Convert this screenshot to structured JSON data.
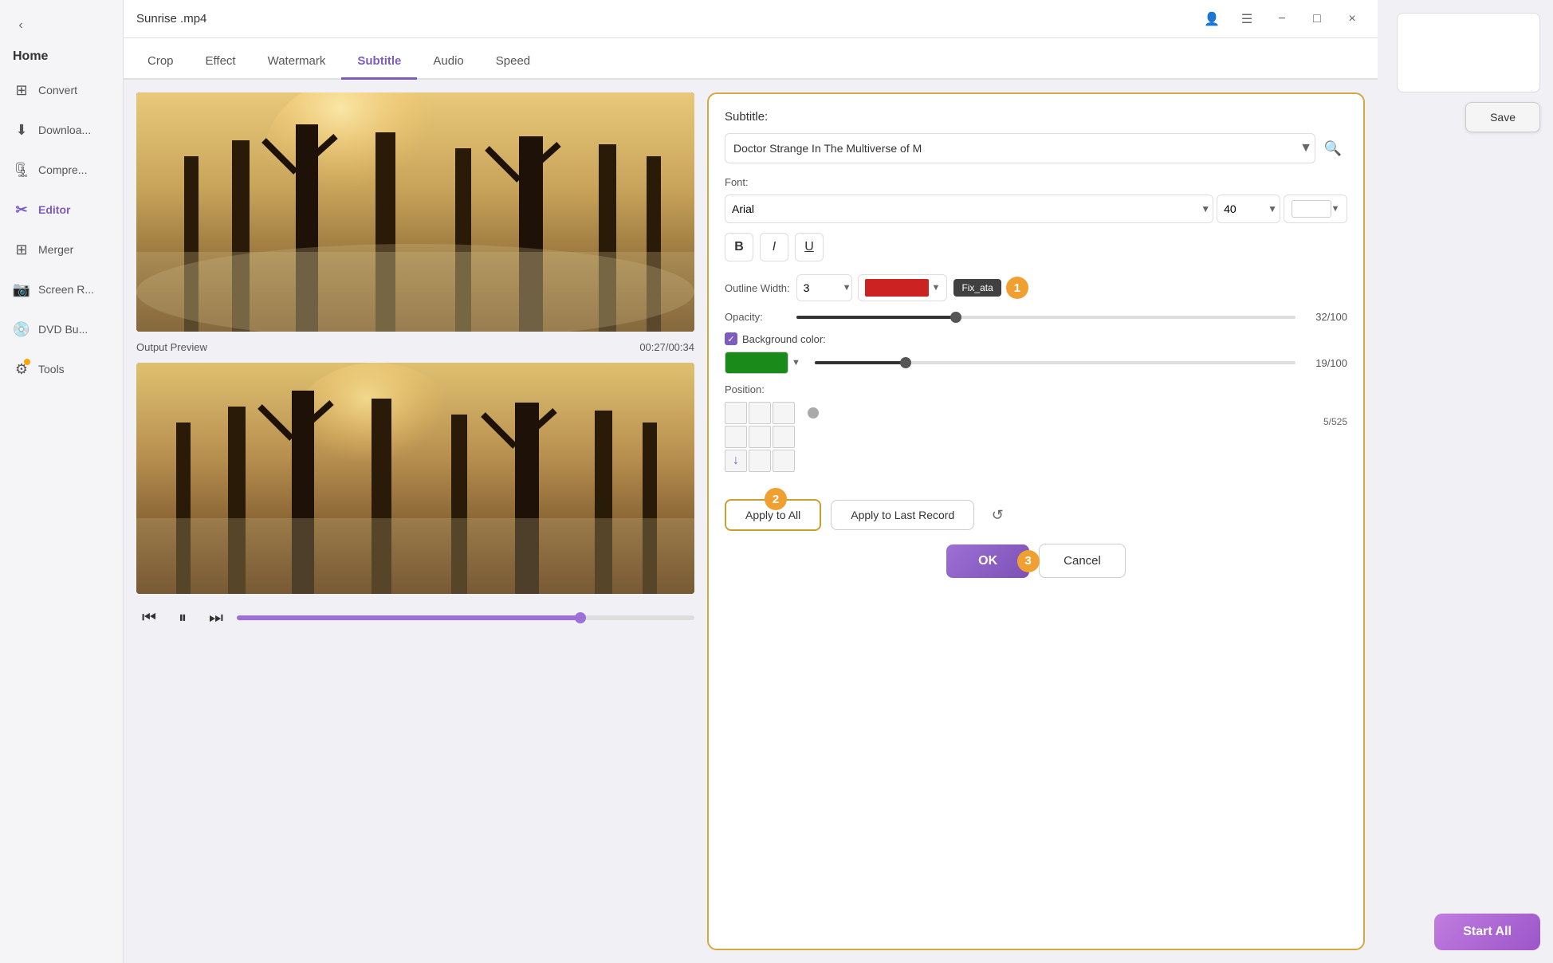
{
  "window": {
    "title": "Sunrise .mp4",
    "close_label": "×",
    "minimize_label": "−",
    "maximize_label": "□"
  },
  "titlebar": {
    "icons": {
      "person": "👤",
      "menu": "☰",
      "minimize": "−",
      "maximize": "□",
      "close": "×"
    }
  },
  "sidebar": {
    "collapse_icon": "‹",
    "home_label": "Home",
    "items": [
      {
        "id": "convert",
        "label": "Convert",
        "icon": "⊞"
      },
      {
        "id": "download",
        "label": "Downloa...",
        "icon": "⊟"
      },
      {
        "id": "compress",
        "label": "Compre...",
        "icon": "⊡"
      },
      {
        "id": "editor",
        "label": "Editor",
        "icon": "✂",
        "active": true
      },
      {
        "id": "merger",
        "label": "Merger",
        "icon": "⊞"
      },
      {
        "id": "screenr",
        "label": "Screen R...",
        "icon": "📷"
      },
      {
        "id": "dvd",
        "label": "DVD Bu...",
        "icon": "💿"
      },
      {
        "id": "tools",
        "label": "Tools",
        "icon": "⚙",
        "badge": true
      }
    ]
  },
  "tabs": [
    {
      "id": "crop",
      "label": "Crop"
    },
    {
      "id": "effect",
      "label": "Effect"
    },
    {
      "id": "watermark",
      "label": "Watermark"
    },
    {
      "id": "subtitle",
      "label": "Subtitle",
      "active": true
    },
    {
      "id": "audio",
      "label": "Audio"
    },
    {
      "id": "speed",
      "label": "Speed"
    }
  ],
  "video": {
    "output_label": "Output Preview",
    "timestamp": "00:27/00:34"
  },
  "subtitle_panel": {
    "title": "Subtitle:",
    "selected_subtitle": "Doctor Strange In The Multiverse of M",
    "font_label": "Font:",
    "font_name": "Arial",
    "font_size": "40",
    "bold_label": "B",
    "italic_label": "I",
    "underline_label": "U",
    "outline_width_label": "Outline Width:",
    "outline_value": "3",
    "tooltip_label": "Fix_ata",
    "badge_1": "1",
    "opacity_label": "Opacity:",
    "opacity_value": "32/100",
    "opacity_pct": 32,
    "bg_color_label": "Background color:",
    "bg_color_checked": true,
    "bg_opacity_value": "19/100",
    "bg_opacity_pct": 19,
    "position_label": "Position:",
    "position_active_cell": 7,
    "position_slider_value": "5/525",
    "badge_2": "2",
    "badge_3": "3",
    "apply_all_label": "Apply to All",
    "apply_last_label": "Apply to Last Record",
    "ok_label": "OK",
    "cancel_label": "Cancel"
  },
  "far_right": {
    "save_label": "Save",
    "start_all_label": "Start All"
  }
}
